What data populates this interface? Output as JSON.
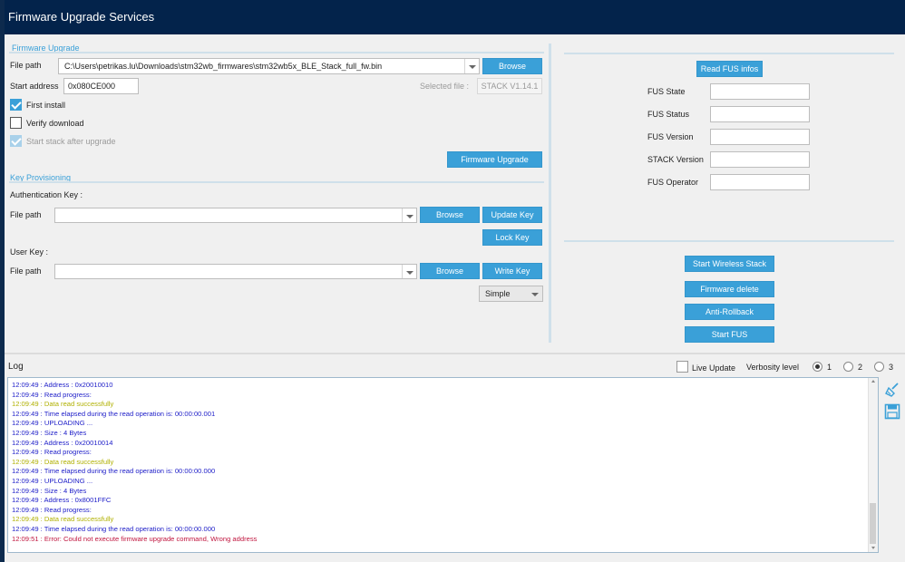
{
  "window": {
    "title": "Firmware Upgrade Services"
  },
  "firmware_upgrade": {
    "section_title": "Firmware Upgrade",
    "file_path_label": "File path",
    "file_path_value": "C:\\Users\\petrikas.lu\\Downloads\\stm32wb_firmwares\\stm32wb5x_BLE_Stack_full_fw.bin",
    "browse_label": "Browse",
    "start_address_label": "Start address",
    "start_address_value": "0x080CE000",
    "selected_file_label": "Selected file :",
    "selected_file_value": "STACK V1.14.1",
    "first_install_label": "First install",
    "verify_download_label": "Verify download",
    "start_stack_label": "Start stack after upgrade",
    "upgrade_button": "Firmware Upgrade",
    "first_install_checked": true,
    "verify_download_checked": false,
    "start_stack_checked": true
  },
  "key_provisioning": {
    "section_title": "Key Provisioning",
    "auth_key_label": "Authentication Key :",
    "file_path_label": "File path",
    "browse_label": "Browse",
    "update_key_label": "Update Key",
    "lock_key_label": "Lock Key",
    "user_key_label": "User Key :",
    "write_key_label": "Write Key",
    "key_type_value": "Simple"
  },
  "fus_info": {
    "read_button": "Read FUS infos",
    "fields": [
      {
        "label": "FUS State",
        "value": ""
      },
      {
        "label": "FUS Status",
        "value": ""
      },
      {
        "label": "FUS Version",
        "value": ""
      },
      {
        "label": "STACK Version",
        "value": ""
      },
      {
        "label": "FUS Operator",
        "value": ""
      }
    ]
  },
  "actions": {
    "start_wireless_stack": "Start Wireless Stack",
    "firmware_delete": "Firmware delete",
    "anti_rollback": "Anti-Rollback",
    "start_fus": "Start FUS"
  },
  "log": {
    "title": "Log",
    "live_update_label": "Live Update",
    "verbosity_label": "Verbosity level",
    "verbosity_options": [
      "1",
      "2",
      "3"
    ],
    "verbosity_selected": "1",
    "lines": [
      {
        "text": "12:09:49 :   Address       : 0x20010010",
        "level": "info"
      },
      {
        "text": "12:09:49 : Read progress:",
        "level": "info"
      },
      {
        "text": "12:09:49 : Data read successfully",
        "level": "success"
      },
      {
        "text": "12:09:49 : Time elapsed during the read operation is: 00:00:00.001",
        "level": "info"
      },
      {
        "text": "12:09:49 : UPLOADING ...",
        "level": "info"
      },
      {
        "text": "12:09:49 :   Size          : 4 Bytes",
        "level": "info"
      },
      {
        "text": "12:09:49 :   Address       : 0x20010014",
        "level": "info"
      },
      {
        "text": "12:09:49 : Read progress:",
        "level": "info"
      },
      {
        "text": "12:09:49 : Data read successfully",
        "level": "success"
      },
      {
        "text": "12:09:49 : Time elapsed during the read operation is: 00:00:00.000",
        "level": "info"
      },
      {
        "text": "12:09:49 : UPLOADING ...",
        "level": "info"
      },
      {
        "text": "12:09:49 :   Size          : 4 Bytes",
        "level": "info"
      },
      {
        "text": "12:09:49 :   Address       : 0x8001FFC",
        "level": "info"
      },
      {
        "text": "12:09:49 : Read progress:",
        "level": "info"
      },
      {
        "text": "12:09:49 : Data read successfully",
        "level": "success"
      },
      {
        "text": "12:09:49 : Time elapsed during the read operation is: 00:00:00.000",
        "level": "info"
      },
      {
        "text": "12:09:51 : Error: Could not execute firmware upgrade command, Wrong address",
        "level": "error"
      }
    ]
  },
  "colors": {
    "title_bar": "#03234b",
    "accent": "#3aa0d8",
    "log_info": "#1d1dc8",
    "log_success": "#b0b000",
    "log_error": "#c0163f"
  }
}
